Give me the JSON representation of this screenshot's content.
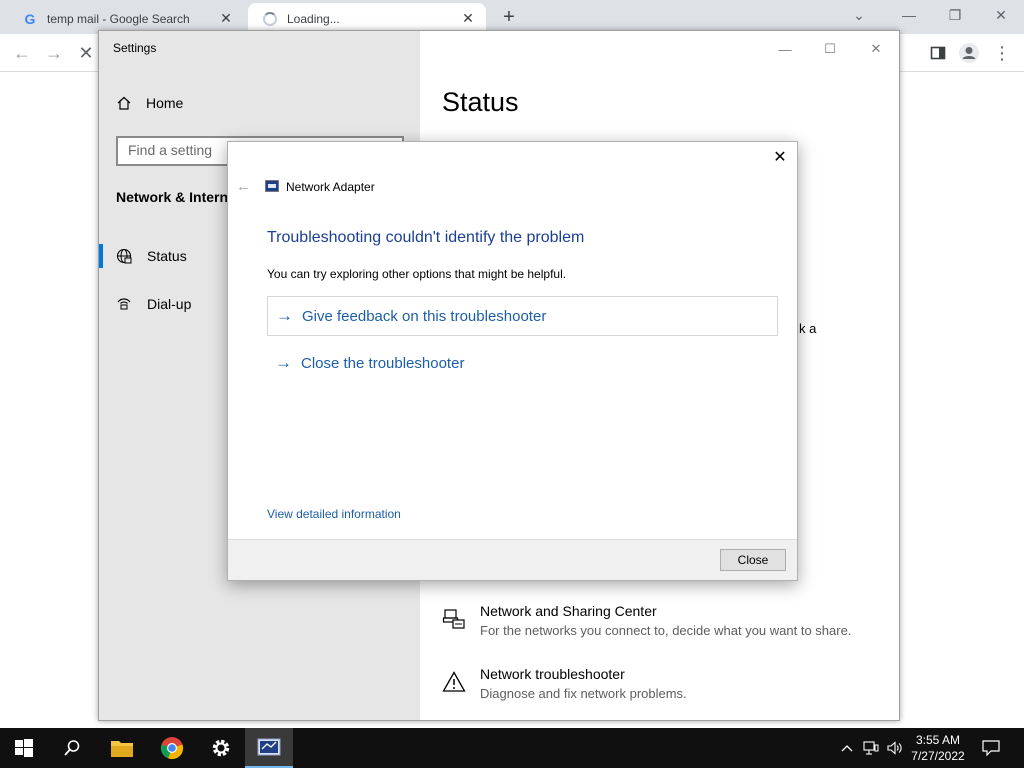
{
  "browser": {
    "tabs": [
      {
        "title": "temp mail - Google Search",
        "favicon": "google-g-icon"
      },
      {
        "title": "Loading...",
        "favicon": "loading-spinner-icon"
      }
    ],
    "new_tab_label": "+"
  },
  "settings": {
    "window_title": "Settings",
    "home_label": "Home",
    "search_placeholder": "Find a setting",
    "section_title": "Network & Interne",
    "nav_items": [
      {
        "label": "Status",
        "icon": "globe-icon",
        "selected": true
      },
      {
        "label": "Dial-up",
        "icon": "dial-up-icon",
        "selected": false
      }
    ],
    "main_title": "Status",
    "obscured_fragment": "k a",
    "options": [
      {
        "title": "Network and Sharing Center",
        "description": "For the networks you connect to, decide what you want to share.",
        "icon": "sharing-center-icon"
      },
      {
        "title": "Network troubleshooter",
        "description": "Diagnose and fix network problems.",
        "icon": "warning-icon"
      }
    ]
  },
  "dialog": {
    "app_title": "Network Adapter",
    "heading": "Troubleshooting couldn't identify the problem",
    "subtext": "You can try exploring other options that might be helpful.",
    "options": [
      {
        "label": "Give feedback on this troubleshooter",
        "icon": "arrow-right-icon"
      },
      {
        "label": "Close the troubleshooter",
        "icon": "arrow-right-icon"
      }
    ],
    "detail_link": "View detailed information",
    "close_button": "Close"
  },
  "taskbar": {
    "time": "3:55 AM",
    "date": "7/27/2022",
    "pinned": [
      "start-icon",
      "search-icon",
      "file-explorer-icon",
      "chrome-icon",
      "settings-gear-icon",
      "network-adapter-icon"
    ]
  },
  "colors": {
    "accent": "#0078d7",
    "link": "#1c5ea8",
    "heading": "#1c3f94",
    "taskbar": "#101010"
  }
}
